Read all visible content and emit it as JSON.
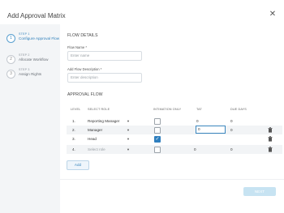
{
  "modal": {
    "title": "Add Approval Matrix",
    "close_icon": "close-icon"
  },
  "steps": [
    {
      "number": "1",
      "step_label": "STEP 1",
      "title": "Configure Approval Flow",
      "active": true
    },
    {
      "number": "2",
      "step_label": "STEP 2",
      "title": "Allocate Workflow",
      "active": false
    },
    {
      "number": "3",
      "step_label": "STEP 3",
      "title": "Assign Rights",
      "active": false
    }
  ],
  "flow_details": {
    "section_title": "FLOW DETAILS",
    "name_label": "Flow Name *",
    "name_placeholder": "Enter name",
    "description_label": "Add Flow Description *",
    "description_placeholder": "Enter description"
  },
  "approval_flow": {
    "section_title": "APPROVAL FLOW",
    "columns": {
      "level": "LEVEL",
      "role": "SELECT ROLE",
      "intimation": "INTIMATION ONLY",
      "tat": "TAT",
      "due_days": "DUE DAYS"
    },
    "rows": [
      {
        "level": "1.",
        "role": "Reporting Manager",
        "intimation": false,
        "tat": "0",
        "due_days": "0",
        "deletable": false,
        "tat_focused": false
      },
      {
        "level": "2.",
        "role": "Manager",
        "intimation": false,
        "tat": "0",
        "due_days": "0",
        "deletable": true,
        "tat_focused": true
      },
      {
        "level": "3.",
        "role": "Head",
        "intimation": true,
        "tat": "",
        "due_days": "",
        "deletable": true,
        "tat_focused": false
      },
      {
        "level": "4.",
        "role": "Select role",
        "intimation": false,
        "tat": "0",
        "due_days": "0",
        "deletable": true,
        "tat_focused": false
      }
    ],
    "add_label": "Add"
  },
  "footer": {
    "next_label": "NEXT"
  },
  "colors": {
    "accent": "#2f7fbf",
    "next_disabled": "#c7e3f2",
    "sidebar_bg": "#f3f5f7"
  }
}
